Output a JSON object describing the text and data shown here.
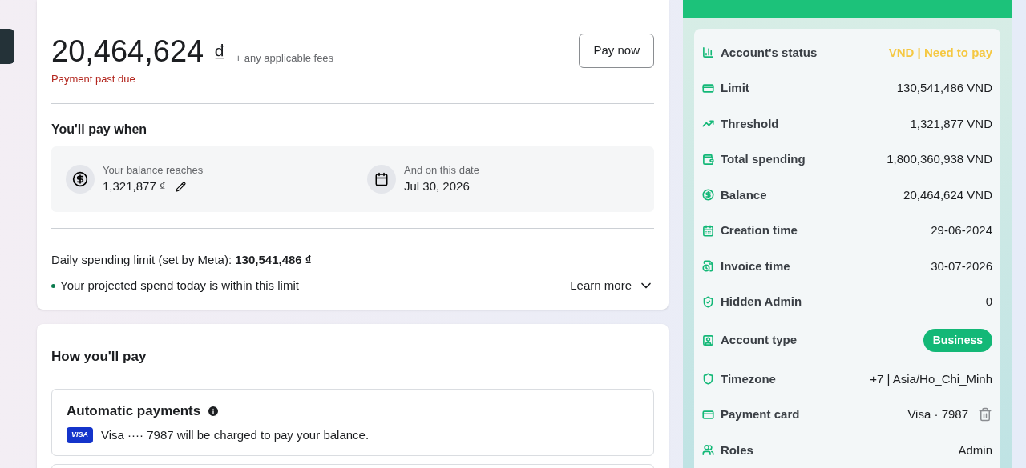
{
  "balance": {
    "amount": "20,464,624",
    "currency": "₫",
    "fees_note": "+ any applicable fees",
    "status": "Payment past due",
    "pay_button": "Pay now"
  },
  "pay_when": {
    "title": "You'll pay when",
    "items": [
      {
        "kind": "threshold",
        "label": "Your balance reaches",
        "value": "1,321,877 ₫"
      },
      {
        "kind": "date",
        "label": "And on this date",
        "value": "Jul 30, 2026"
      }
    ]
  },
  "daily_limit": {
    "label": "Daily spending limit (set by Meta): **130,541,486 ₫**",
    "note": "Your projected spend today is within this limit",
    "learn_more": "Learn more"
  },
  "how_pay": {
    "title": "How you'll pay",
    "method_title": "Automatic payments",
    "card_brand": "VISA",
    "card_text": "Visa ···· 7987 will be charged to pay your balance."
  },
  "account_info": [
    {
      "kind": "status",
      "label": "Account's status",
      "value": "VND | Need to pay"
    },
    {
      "kind": "text",
      "label": "Limit",
      "value": "130,541,486 VND"
    },
    {
      "kind": "text",
      "label": "Threshold",
      "value": "1,321,877 VND"
    },
    {
      "kind": "text",
      "label": "Total spending",
      "value": "1,800,360,938 VND"
    },
    {
      "kind": "text",
      "label": "Balance",
      "value": "20,464,624 VND"
    },
    {
      "kind": "text",
      "label": "Creation time",
      "value": "29-06-2024"
    },
    {
      "kind": "text",
      "label": "Invoice time",
      "value": "30-07-2026"
    },
    {
      "kind": "text",
      "label": "Hidden Admin",
      "value": "0"
    },
    {
      "kind": "pill",
      "label": "Account type",
      "value": "Business"
    },
    {
      "kind": "text",
      "label": "Timezone",
      "value": "+7 | Asia/Ho_Chi_Minh"
    },
    {
      "kind": "card",
      "label": "Payment card",
      "value": "Visa · 7987"
    },
    {
      "kind": "text",
      "label": "Roles",
      "value": "Admin"
    }
  ]
}
